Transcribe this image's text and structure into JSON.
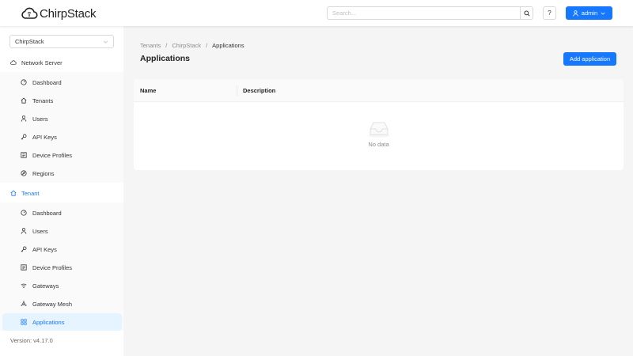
{
  "app": {
    "logo_text": "ChirpStack"
  },
  "header": {
    "search_placeholder": "Search...",
    "help_label": "?",
    "user_label": "admin"
  },
  "sidebar": {
    "tenant_select_value": "ChirpStack",
    "network_server": {
      "label": "Network Server",
      "items": [
        {
          "label": "Dashboard",
          "icon": "dashboard-icon"
        },
        {
          "label": "Tenants",
          "icon": "home-icon"
        },
        {
          "label": "Users",
          "icon": "user-icon"
        },
        {
          "label": "API Keys",
          "icon": "key-icon"
        },
        {
          "label": "Device Profiles",
          "icon": "profile-icon"
        },
        {
          "label": "Regions",
          "icon": "compass-icon"
        }
      ]
    },
    "tenant": {
      "label": "Tenant",
      "items": [
        {
          "label": "Dashboard",
          "icon": "dashboard-icon"
        },
        {
          "label": "Users",
          "icon": "user-icon"
        },
        {
          "label": "API Keys",
          "icon": "key-icon"
        },
        {
          "label": "Device Profiles",
          "icon": "profile-icon"
        },
        {
          "label": "Gateways",
          "icon": "wifi-icon"
        },
        {
          "label": "Gateway Mesh",
          "icon": "mesh-icon"
        },
        {
          "label": "Applications",
          "icon": "appstore-icon"
        }
      ]
    },
    "version": "Version: v4.17.0"
  },
  "main": {
    "breadcrumb": [
      "Tenants",
      "ChirpStack",
      "Applications"
    ],
    "breadcrumb_sep": "/",
    "title": "Applications",
    "add_button": "Add application",
    "table": {
      "columns": [
        "Name",
        "Description"
      ],
      "empty_text": "No data"
    }
  },
  "colors": {
    "primary": "#1677ff",
    "selected_bg": "#e6f4ff"
  }
}
